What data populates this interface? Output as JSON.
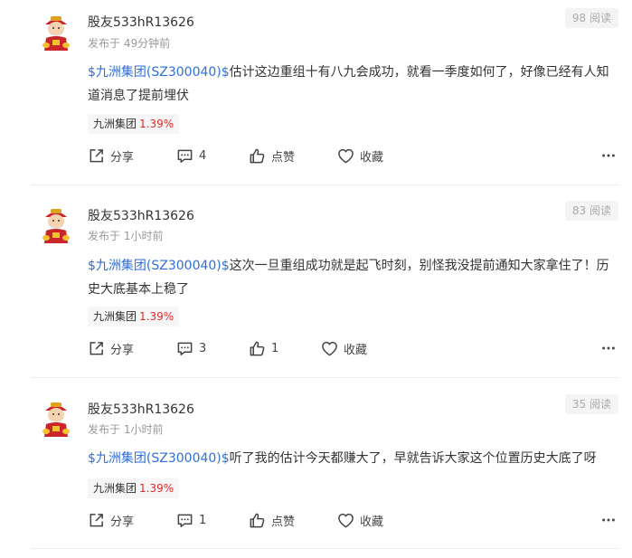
{
  "posts": [
    {
      "username": "股友533hR13626",
      "time": "发布于 49分钟前",
      "reads": "98 阅读",
      "stock_mention": "$九洲集团(SZ300040)$",
      "text": "估计这边重组十有八九会成功，就看一季度如何了，好像已经有人知道消息了提前埋伏",
      "tag_name": "九洲集团",
      "tag_change": "1.39%",
      "share_label": "分享",
      "comment_count": "4",
      "like_label": "点赞",
      "collect_label": "收藏"
    },
    {
      "username": "股友533hR13626",
      "time": "发布于 1小时前",
      "reads": "83 阅读",
      "stock_mention": "$九洲集团(SZ300040)$",
      "text": "这次一旦重组成功就是起飞时刻，别怪我没提前通知大家拿住了！历史大底基本上稳了",
      "tag_name": "九洲集团",
      "tag_change": "1.39%",
      "share_label": "分享",
      "comment_count": "3",
      "like_label": "1",
      "collect_label": "收藏"
    },
    {
      "username": "股友533hR13626",
      "time": "发布于 1小时前",
      "reads": "35 阅读",
      "stock_mention": "$九洲集团(SZ300040)$",
      "text": "听了我的估计今天都赚大了，早就告诉大家这个位置历史大底了呀",
      "tag_name": "九洲集团",
      "tag_change": "1.39%",
      "share_label": "分享",
      "comment_count": "1",
      "like_label": "点赞",
      "collect_label": "收藏"
    }
  ],
  "colors": {
    "stock_link": "#2f6fd8",
    "change_up": "#e32929",
    "meta": "#999999"
  },
  "icons": [
    "avatar-caishen",
    "share-icon",
    "comment-icon",
    "like-icon",
    "collect-icon",
    "more-icon"
  ]
}
